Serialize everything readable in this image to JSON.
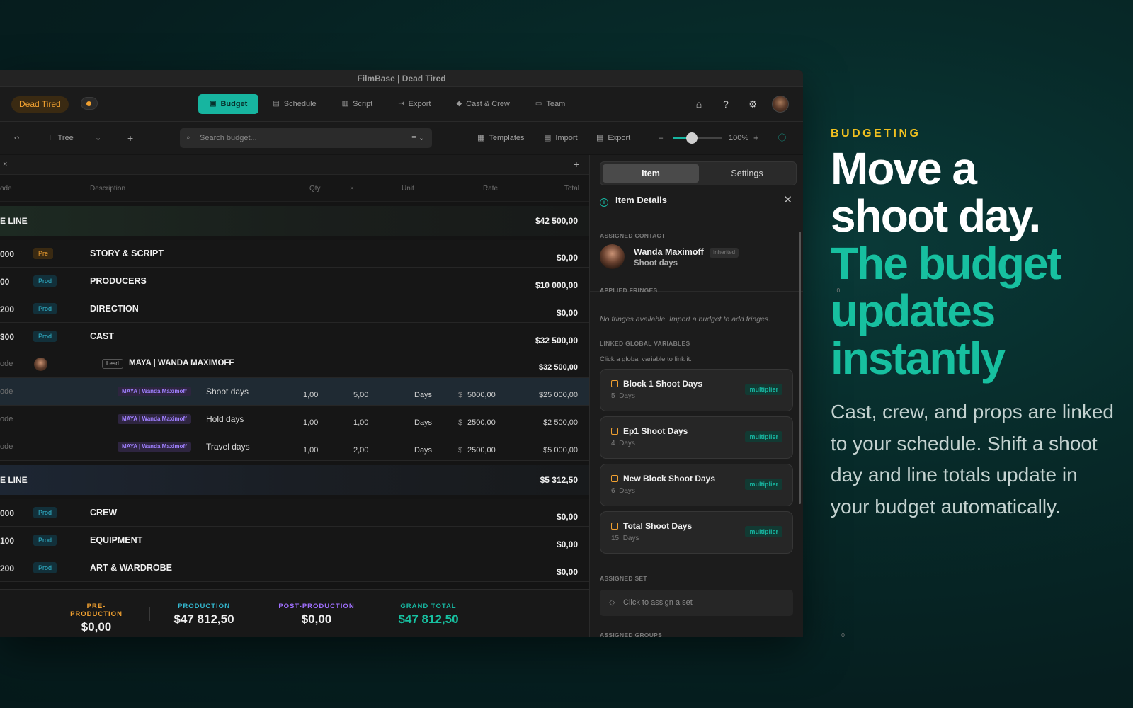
{
  "window": {
    "title": "FilmBase | Dead Tired"
  },
  "topnav": {
    "project": "Dead Tired",
    "tabs": [
      {
        "label": "Budget",
        "icon": "budget-icon",
        "active": true
      },
      {
        "label": "Schedule",
        "icon": "calendar-icon"
      },
      {
        "label": "Script",
        "icon": "script-icon"
      },
      {
        "label": "Export",
        "icon": "export-icon"
      },
      {
        "label": "Cast & Crew",
        "icon": "people-icon"
      },
      {
        "label": "Team",
        "icon": "chat-icon"
      }
    ]
  },
  "toolbar": {
    "view_label": "Tree",
    "search_placeholder": "Search budget...",
    "templates": "Templates",
    "import": "Import",
    "export": "Export",
    "zoom": "100%",
    "zoom_level": 0.38
  },
  "table": {
    "columns": {
      "code": "ode",
      "description": "Description",
      "qty": "Qty",
      "times": "×",
      "unit": "Unit",
      "rate": "Rate",
      "total": "Total"
    },
    "groups": [
      {
        "label": "E LINE",
        "total": "$42 500,00"
      },
      {
        "label": "E LINE",
        "total": "$5 312,50"
      }
    ],
    "rows_top": [
      {
        "code": "000",
        "phase": "Pre",
        "desc": "STORY & SCRIPT",
        "total": "$0,00"
      },
      {
        "code": "00",
        "phase": "Prod",
        "desc": "PRODUCERS",
        "total": "$10 000,00"
      },
      {
        "code": "200",
        "phase": "Prod",
        "desc": "DIRECTION",
        "total": "$0,00"
      },
      {
        "code": "300",
        "phase": "Prod",
        "desc": "CAST",
        "total": "$32 500,00"
      }
    ],
    "cast_row": {
      "code": "ode",
      "lead": "Lead",
      "desc": "MAYA | WANDA MAXIMOFF",
      "total": "$32 500,00"
    },
    "detail_rows": [
      {
        "code": "ode",
        "chip": "MAYA | Wanda Maximoff",
        "desc": "Shoot days",
        "qty": "1,00",
        "x": "5,00",
        "unit": "Days",
        "cur": "$",
        "rate": "5000,00",
        "total": "$25 000,00"
      },
      {
        "code": "ode",
        "chip": "MAYA | Wanda Maximoff",
        "desc": "Hold days",
        "qty": "1,00",
        "x": "1,00",
        "unit": "Days",
        "cur": "$",
        "rate": "2500,00",
        "total": "$2 500,00"
      },
      {
        "code": "ode",
        "chip": "MAYA | Wanda Maximoff",
        "desc": "Travel days",
        "qty": "1,00",
        "x": "2,00",
        "unit": "Days",
        "cur": "$",
        "rate": "2500,00",
        "total": "$5 000,00"
      }
    ],
    "rows_bottom": [
      {
        "code": "000",
        "phase": "Prod",
        "desc": "CREW",
        "total": "$0,00"
      },
      {
        "code": "100",
        "phase": "Prod",
        "desc": "EQUIPMENT",
        "total": "$0,00"
      },
      {
        "code": "200",
        "phase": "Prod",
        "desc": "ART & WARDROBE",
        "total": "$0,00"
      }
    ]
  },
  "footer": {
    "pre_label": "PRE-PRODUCTION",
    "pre_value": "$0,00",
    "prod_label": "PRODUCTION",
    "prod_value": "$47 812,50",
    "post_label": "POST-PRODUCTION",
    "post_value": "$0,00",
    "grand_label": "GRAND TOTAL",
    "grand_value": "$47 812,50"
  },
  "panel": {
    "tab_item": "Item",
    "tab_settings": "Settings",
    "title": "Item Details",
    "assigned_contact_label": "ASSIGNED CONTACT",
    "contact_name": "Wanda Maximoff",
    "contact_badge": "Inherited",
    "contact_role": "Shoot days",
    "fringes_label": "APPLIED FRINGES",
    "fringes_count": "0",
    "fringes_empty": "No fringes available. Import a budget to add fringes.",
    "globals_label": "LINKED GLOBAL VARIABLES",
    "globals_hint": "Click a global variable to link it:",
    "variables": [
      {
        "name": "Block 1 Shoot Days",
        "value": "5",
        "unit": "Days",
        "badge": "multiplier"
      },
      {
        "name": "Ep1 Shoot Days",
        "value": "4",
        "unit": "Days",
        "badge": "multiplier"
      },
      {
        "name": "New Block Shoot Days",
        "value": "6",
        "unit": "Days",
        "badge": "multiplier"
      },
      {
        "name": "Total Shoot Days",
        "value": "15",
        "unit": "Days",
        "badge": "multiplier"
      }
    ],
    "set_label": "ASSIGNED SET",
    "set_placeholder": "Click to assign a set",
    "groups_label": "ASSIGNED GROUPS",
    "groups_count": "0"
  },
  "promo": {
    "eyebrow": "BUDGETING",
    "headline_white_1": "Move a",
    "headline_white_2": "shoot day.",
    "headline_teal_1": "The budget",
    "headline_teal_2": "updates",
    "headline_teal_3": "instantly",
    "body": "Cast, crew, and props are linked to your schedule. Shift a shoot day and line totals update in your budget automatically."
  },
  "colors": {
    "accent_teal": "#17b5a0",
    "pre_orange": "#f0a030",
    "prod_blue": "#33b8d0",
    "post_purple": "#a070ff",
    "eyebrow_yellow": "#f0c020"
  }
}
